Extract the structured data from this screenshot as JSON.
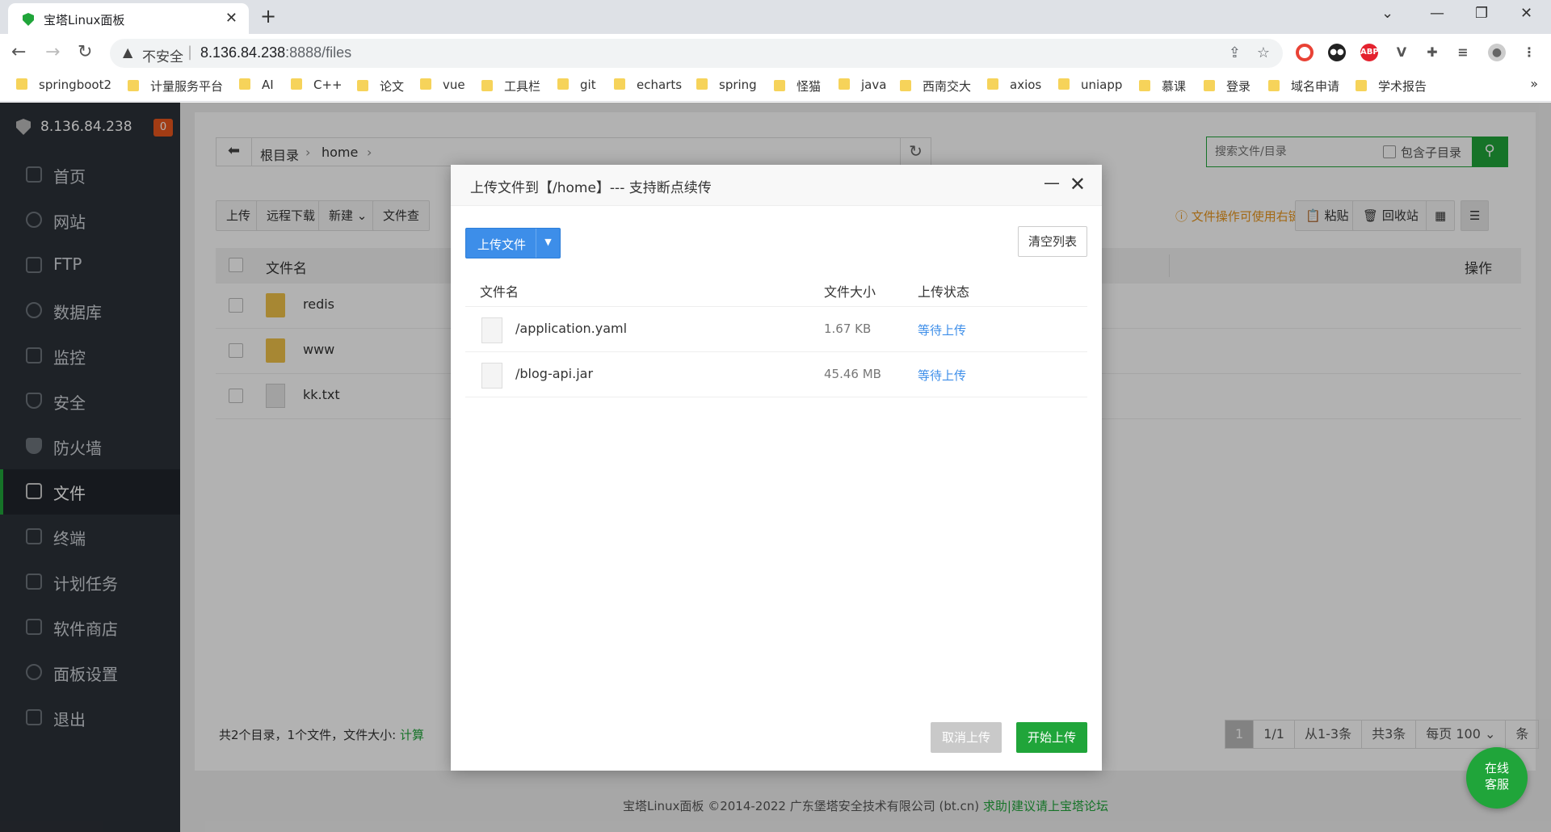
{
  "browser": {
    "tab_title": "宝塔Linux面板",
    "insecure_label": "不安全",
    "url_host": "8.136.84.238",
    "url_path": ":8888/files",
    "bookmarks": [
      "springboot2",
      "计量服务平台",
      "AI",
      "C++",
      "论文",
      "vue",
      "工具栏",
      "git",
      "echarts",
      "spring",
      "怪猫",
      "java",
      "西南交大",
      "axios",
      "uniapp",
      "慕课",
      "登录",
      "域名申请",
      "学术报告"
    ]
  },
  "sidebar": {
    "server_ip": "8.136.84.238",
    "badge_count": "0",
    "items": [
      {
        "label": "首页"
      },
      {
        "label": "网站"
      },
      {
        "label": "FTP"
      },
      {
        "label": "数据库"
      },
      {
        "label": "监控"
      },
      {
        "label": "安全"
      },
      {
        "label": "防火墙"
      },
      {
        "label": "文件"
      },
      {
        "label": "终端"
      },
      {
        "label": "计划任务"
      },
      {
        "label": "软件商店"
      },
      {
        "label": "面板设置"
      },
      {
        "label": "退出"
      }
    ],
    "active_item": "文件"
  },
  "files": {
    "breadcrumb": [
      "根目录",
      "home"
    ],
    "search_placeholder": "搜索文件/目录",
    "include_subdir_label": "包含子目录",
    "toolbar": {
      "upload": "上传",
      "remote_download": "远程下载",
      "new": "新建",
      "file_partial": "文件查",
      "paste": "粘贴",
      "recycle": "回收站"
    },
    "tip": "文件操作可使用右键",
    "columns": {
      "name": "文件名",
      "ops": "操作"
    },
    "rows": [
      {
        "name": "redis",
        "type": "folder"
      },
      {
        "name": "www",
        "type": "folder"
      },
      {
        "name": "kk.txt",
        "type": "file"
      }
    ],
    "summary_text": "共2个目录，1个文件，文件大小:",
    "summary_calc": "计算",
    "pager": {
      "current": "1",
      "pages": "1/1",
      "range": "从1-3条",
      "total": "共3条",
      "per_page_label": "每页",
      "per_page_value": "100",
      "unit": "条"
    }
  },
  "footer": {
    "copyright": "宝塔Linux面板 ©2014-2022 广东堡塔安全技术有限公司 (bt.cn)",
    "link": "求助|建议请上宝塔论坛"
  },
  "chat": {
    "line1": "在线",
    "line2": "客服"
  },
  "modal": {
    "title": "上传文件到【/home】--- 支持断点续传",
    "upload_button": "上传文件",
    "clear_button": "清空列表",
    "columns": {
      "name": "文件名",
      "size": "文件大小",
      "status": "上传状态"
    },
    "rows": [
      {
        "name": "/application.yaml",
        "size": "1.67 KB",
        "status": "等待上传"
      },
      {
        "name": "/blog-api.jar",
        "size": "45.46 MB",
        "status": "等待上传"
      }
    ],
    "cancel_button": "取消上传",
    "start_button": "开始上传"
  },
  "colors": {
    "brand_green": "#20a53a",
    "blue": "#3d8ee9",
    "sidebar_bg": "#2c3138",
    "tip_orange": "#e8961e"
  }
}
